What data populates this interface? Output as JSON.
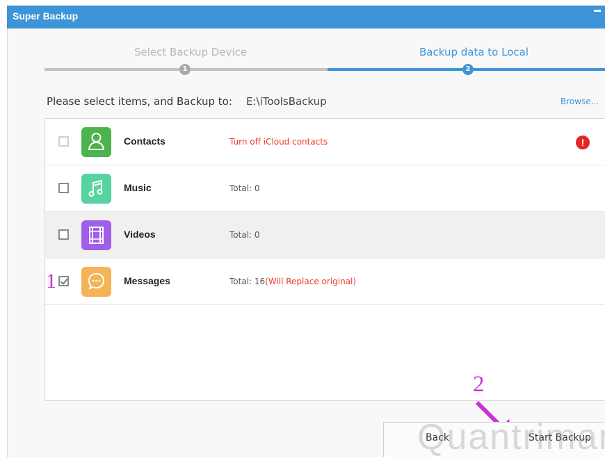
{
  "window": {
    "title": "Super Backup"
  },
  "steps": [
    {
      "label": "Select Backup Device",
      "number": "1"
    },
    {
      "label": "Backup data to Local",
      "number": "2"
    }
  ],
  "destination": {
    "prompt": "Please select items, and Backup to:",
    "path": "E:\\iToolsBackup",
    "browse_label": "Browse..."
  },
  "items": [
    {
      "name": "Contacts",
      "status": "Turn off iCloud contacts",
      "checked": false,
      "disabled": true,
      "icon": "contacts-icon",
      "color": "#4db34d"
    },
    {
      "name": "Music",
      "status": "Total: 0",
      "checked": false,
      "icon": "music-note-icon",
      "color": "#56d39e"
    },
    {
      "name": "Videos",
      "status": "Total: 0",
      "checked": false,
      "icon": "film-icon",
      "color": "#a15ee8"
    },
    {
      "name": "Messages",
      "status": "Total: 16",
      "status_note": "(Will Replace original)",
      "checked": true,
      "icon": "chat-bubble-icon",
      "color": "#f4b455"
    }
  ],
  "annotations": {
    "marker_1": "1",
    "marker_2": "2"
  },
  "buttons": {
    "back": "Back",
    "start": "Start Backup"
  },
  "watermark": "Quantrimang",
  "colors": {
    "accent": "#3d95d8",
    "warning": "#e52626",
    "annotation": "#cc30d8"
  }
}
